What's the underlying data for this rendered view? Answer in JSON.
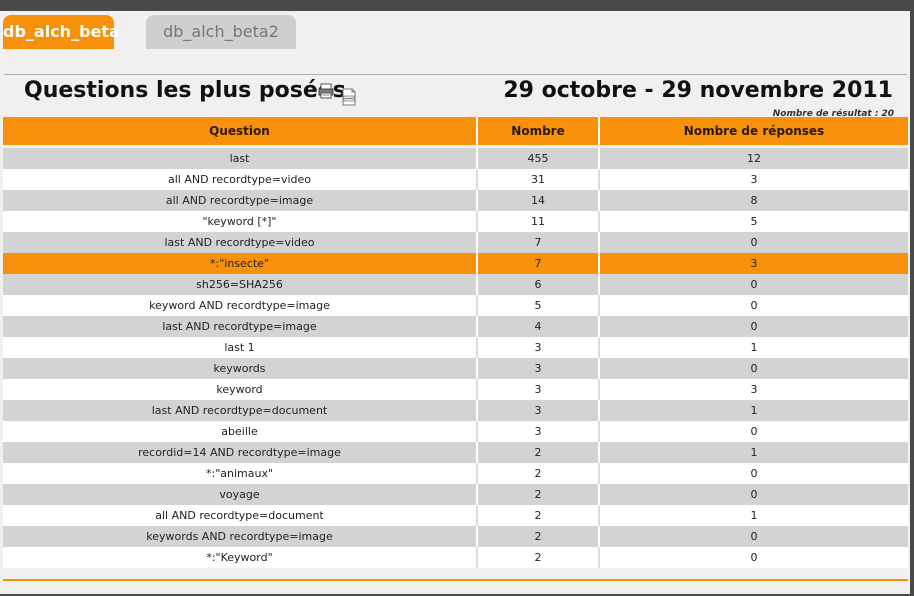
{
  "tabs": [
    {
      "label": "db_alch_beta",
      "active": true
    },
    {
      "label": "db_alch_beta2",
      "active": false
    }
  ],
  "header": {
    "title": "Questions les plus posées",
    "period": "29 octobre - 29 novembre 2011",
    "result_label": "Nombre de résultat :",
    "result_count": "20"
  },
  "icons": {
    "print": "printer-icon",
    "export": "csv-export-icon"
  },
  "colors": {
    "accent": "#f7900b",
    "row_alt": "#d3d3d3",
    "row_plain": "#ffffff"
  },
  "table": {
    "columns": [
      "Question",
      "Nombre",
      "Nombre de réponses"
    ],
    "rows": [
      {
        "question": "last",
        "count": "455",
        "answers": "12"
      },
      {
        "question": "all AND recordtype=video",
        "count": "31",
        "answers": "3"
      },
      {
        "question": "all AND recordtype=image",
        "count": "14",
        "answers": "8"
      },
      {
        "question": "\"keyword [*]\"",
        "count": "11",
        "answers": "5"
      },
      {
        "question": "last AND recordtype=video",
        "count": "7",
        "answers": "0"
      },
      {
        "question": "*:\"insecte\"",
        "count": "7",
        "answers": "3",
        "highlighted": true
      },
      {
        "question": "sh256=SHA256",
        "count": "6",
        "answers": "0"
      },
      {
        "question": "keyword AND recordtype=image",
        "count": "5",
        "answers": "0"
      },
      {
        "question": "last AND recordtype=image",
        "count": "4",
        "answers": "0"
      },
      {
        "question": "last 1",
        "count": "3",
        "answers": "1"
      },
      {
        "question": "keywords",
        "count": "3",
        "answers": "0"
      },
      {
        "question": "keyword",
        "count": "3",
        "answers": "3"
      },
      {
        "question": "last AND recordtype=document",
        "count": "3",
        "answers": "1"
      },
      {
        "question": "abeille",
        "count": "3",
        "answers": "0"
      },
      {
        "question": "recordid=14 AND recordtype=image",
        "count": "2",
        "answers": "1"
      },
      {
        "question": "*:\"animaux\"",
        "count": "2",
        "answers": "0"
      },
      {
        "question": "voyage",
        "count": "2",
        "answers": "0"
      },
      {
        "question": "all AND recordtype=document",
        "count": "2",
        "answers": "1"
      },
      {
        "question": "keywords AND recordtype=image",
        "count": "2",
        "answers": "0"
      },
      {
        "question": "*:\"Keyword\"",
        "count": "2",
        "answers": "0"
      }
    ]
  }
}
